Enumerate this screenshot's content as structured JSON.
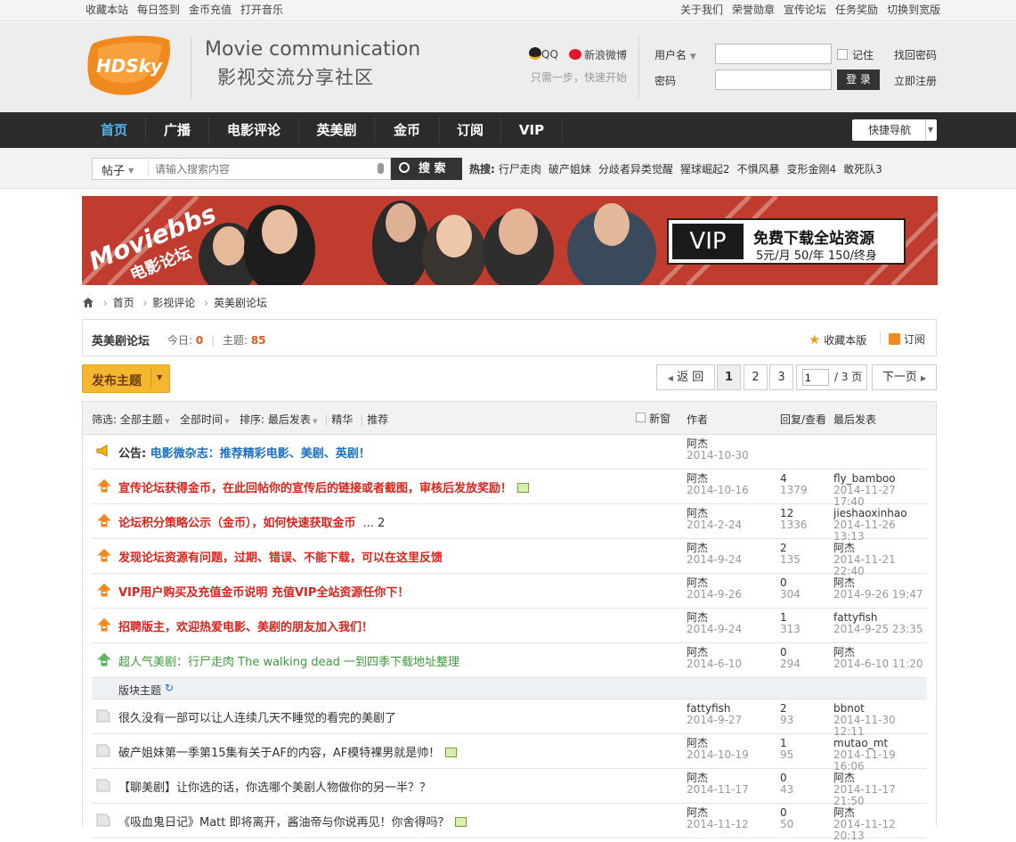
{
  "topbar": {
    "left_links": [
      "收藏本站",
      "每日签到",
      "金币充值",
      "打开音乐"
    ],
    "right_links": [
      "关于我们",
      "荣誉勋章",
      "宣传论坛",
      "任务奖励",
      "切换到宽版"
    ]
  },
  "header": {
    "logo_text": "HDSky",
    "tagline_en": "Movie communication",
    "tagline_cn": "影视交流分享社区",
    "qq_label": "QQ",
    "weibo_label": "新浪微博",
    "social_hint": "只需一步，快速开始",
    "username_label": "用户名",
    "password_label": "密码",
    "remember_label": "记住",
    "forgot_label": "找回密码",
    "login_button": "登 录",
    "register_link": "立即注册"
  },
  "nav": {
    "items": [
      "首页",
      "广播",
      "电影评论",
      "英美剧",
      "金币",
      "订阅",
      "VIP"
    ],
    "quick_nav": "快捷导航"
  },
  "search": {
    "type": "帖子",
    "placeholder": "请输入搜索内容",
    "button": "搜 索",
    "hot_label": "热搜:",
    "hot_items": [
      "行尸走肉",
      "破产姐妹",
      "分歧者异类觉醒",
      "猩球崛起2",
      "不惧风暴",
      "变形金刚4",
      "敢死队3"
    ]
  },
  "banner": {
    "left_text": "Moviebbs",
    "left_text2": "电影论坛",
    "vip_label": "VIP",
    "vip_title": "免费下载全站资源",
    "vip_price": "5元/月 50/年 150/终身"
  },
  "breadcrumb": [
    "首页",
    "影视评论",
    "英美剧论坛"
  ],
  "forum": {
    "name": "英美剧论坛",
    "today_label": "今日:",
    "today_value": "0",
    "topics_label": "主题:",
    "topics_value": "85",
    "favorite": "收藏本版",
    "subscribe": "订阅"
  },
  "toolbar": {
    "post_button": "发布主题",
    "back": "返 回",
    "pages": [
      "1",
      "2",
      "3"
    ],
    "page_input": "1",
    "page_total": "/ 3 页",
    "next": "下一页"
  },
  "filter": {
    "label": "筛选:",
    "all_topics": "全部主题",
    "all_time": "全部时间",
    "sort": "排序: 最后发表",
    "digest": "精华",
    "recommend": "推荐",
    "new_window": "新窗",
    "col_author": "作者",
    "col_replies": "回复/查看",
    "col_last": "最后发表"
  },
  "announcement": {
    "prefix": "公告:",
    "title": "电影微杂志：推荐精彩电影、美剧、英剧！",
    "author": "阿杰",
    "date": "2014-10-30"
  },
  "sticky_threads": [
    {
      "title": "宣传论坛获得金币，在此回帖你的宣传后的链接或者截图，审核后发放奖励！",
      "color": "#d9241c",
      "img": true,
      "pages": "",
      "author": "阿杰",
      "date": "2014-10-16",
      "replies": "4",
      "views": "1379",
      "last_user": "fly_bamboo",
      "last_date": "2014-11-27 17:40"
    },
    {
      "title": "论坛积分策略公示（金币），如何快速获取金币",
      "color": "#d9241c",
      "img": false,
      "pages": "... 2",
      "author": "阿杰",
      "date": "2014-2-24",
      "replies": "12",
      "views": "1336",
      "last_user": "jieshaoxinhao",
      "last_date": "2014-11-26 13:13"
    },
    {
      "title": "发现论坛资源有问题，过期、错误、不能下载，可以在这里反馈",
      "color": "#d9241c",
      "img": false,
      "pages": "",
      "author": "阿杰",
      "date": "2014-9-24",
      "replies": "2",
      "views": "135",
      "last_user": "阿杰",
      "last_date": "2014-11-21 22:40"
    },
    {
      "title": "VIP用户购买及充值金币说明 充值VIP全站资源任你下！",
      "color": "#d9241c",
      "img": false,
      "pages": "",
      "author": "阿杰",
      "date": "2014-9-26",
      "replies": "0",
      "views": "304",
      "last_user": "阿杰",
      "last_date": "2014-9-26 19:47"
    },
    {
      "title": "招聘版主，欢迎热爱电影、美剧的朋友加入我们！",
      "color": "#d9241c",
      "img": false,
      "pages": "",
      "author": "阿杰",
      "date": "2014-9-24",
      "replies": "1",
      "views": "313",
      "last_user": "fattyfish",
      "last_date": "2014-9-25 23:35"
    },
    {
      "title": "超人气美剧：行尸走肉 The walking dead 一到四季下载地址整理",
      "color": "#3c9a3c",
      "img": false,
      "pages": "",
      "author": "阿杰",
      "date": "2014-6-10",
      "replies": "0",
      "views": "294",
      "last_user": "阿杰",
      "last_date": "2014-6-10 11:20"
    }
  ],
  "section_label": "版块主题",
  "threads": [
    {
      "title": "很久没有一部可以让人连续几天不睡觉的看完的美剧了",
      "img": false,
      "author": "fattyfish",
      "date": "2014-9-27",
      "replies": "2",
      "views": "93",
      "last_user": "bbnot",
      "last_date": "2014-11-30 12:11"
    },
    {
      "title": "破产姐妹第一季第15集有关于AF的内容，AF模特裸男就是帅！",
      "img": true,
      "author": "阿杰",
      "date": "2014-10-19",
      "replies": "1",
      "views": "95",
      "last_user": "mutao_mt",
      "last_date": "2014-11-19 16:06"
    },
    {
      "title": "【聊美剧】让你选的话，你选哪个美剧人物做你的另一半？？",
      "img": false,
      "author": "阿杰",
      "date": "2014-11-17",
      "replies": "0",
      "views": "43",
      "last_user": "阿杰",
      "last_date": "2014-11-17 21:50"
    },
    {
      "title": "《吸血鬼日记》Matt 即将离开，酱油帝与你说再见！你舍得吗？",
      "img": true,
      "author": "阿杰",
      "date": "2014-11-12",
      "replies": "0",
      "views": "50",
      "last_user": "阿杰",
      "last_date": "2014-11-12 20:13"
    }
  ]
}
